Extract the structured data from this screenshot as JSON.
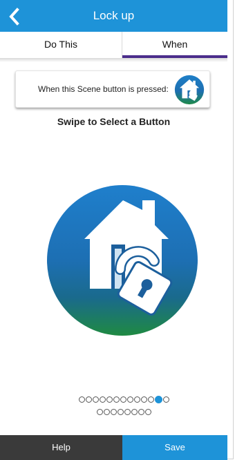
{
  "header": {
    "title": "Lock up",
    "back_icon": "chevron-left-icon"
  },
  "tabs": [
    {
      "label": "Do This",
      "selected": false
    },
    {
      "label": "When",
      "selected": true
    }
  ],
  "card": {
    "text": "When this Scene button is pressed:",
    "icon": "home-lock-icon"
  },
  "subtitle": "Swipe to Select a Button",
  "selected_button_icon": "home-lock-icon",
  "pager": {
    "total": 21,
    "active_index": 11
  },
  "footer": {
    "help_label": "Help",
    "save_label": "Save"
  },
  "colors": {
    "accent": "#1e93d8",
    "tab_indicator": "#4b2d8b",
    "help_bg": "#3a3a3a",
    "icon_green": "#1f8a4a"
  }
}
